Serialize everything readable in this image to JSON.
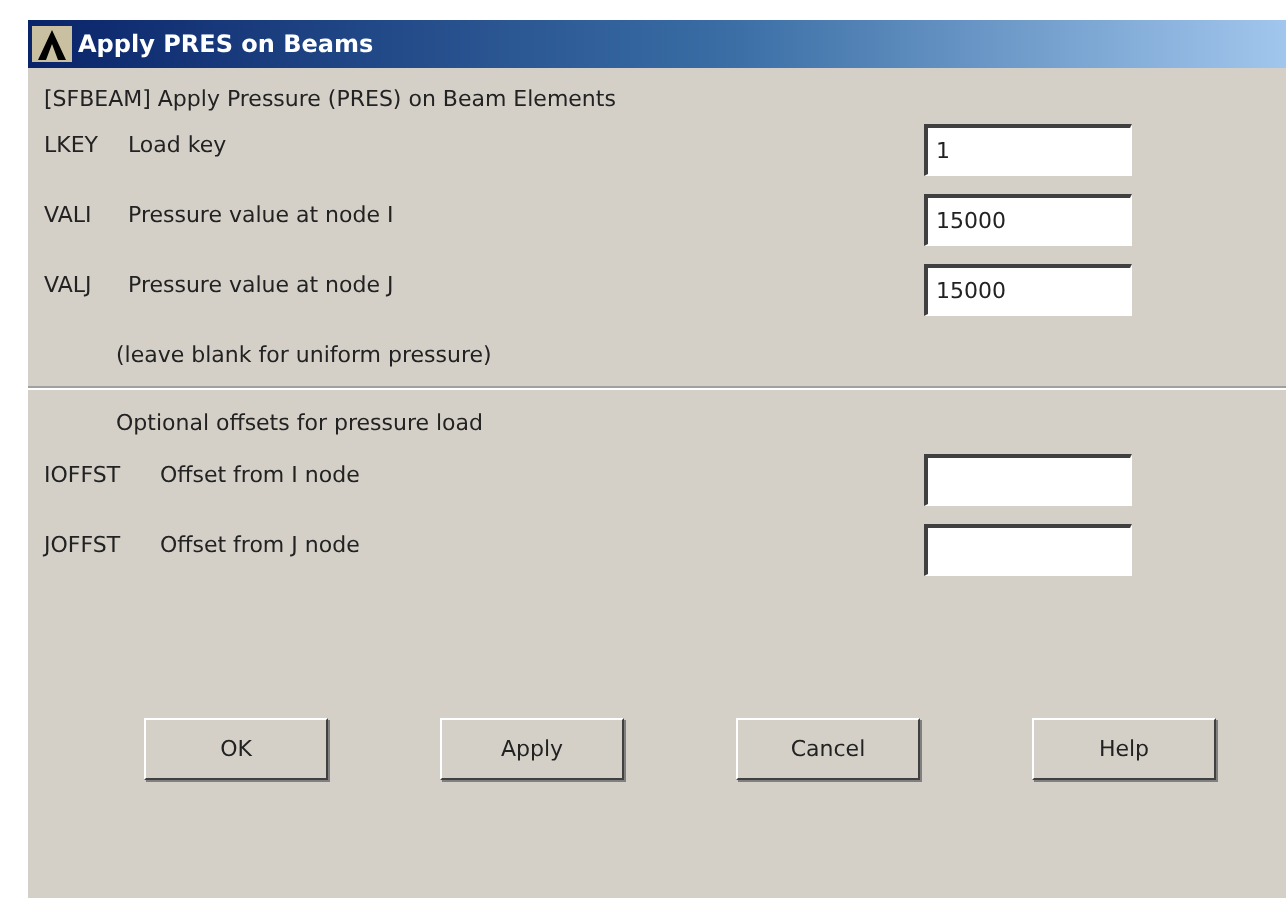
{
  "window": {
    "title": "Apply PRES on Beams"
  },
  "header": "[SFBEAM]  Apply Pressure (PRES) on Beam Elements",
  "fields": [
    {
      "key": "LKEY",
      "label": "Load key",
      "value": "1"
    },
    {
      "key": "VALI",
      "label": "Pressure value at node I",
      "value": "15000"
    },
    {
      "key": "VALJ",
      "label": "Pressure value at node J",
      "value": "15000"
    }
  ],
  "note": "(leave blank for uniform pressure)",
  "section": "Optional offsets for pressure load",
  "offsets": [
    {
      "key": "IOFFST",
      "label": "Offset from I node"
    },
    {
      "key": "JOFFST",
      "label": "Offset from J node"
    }
  ],
  "buttons": [
    "OK",
    "Apply",
    "Cancel",
    "Help"
  ]
}
